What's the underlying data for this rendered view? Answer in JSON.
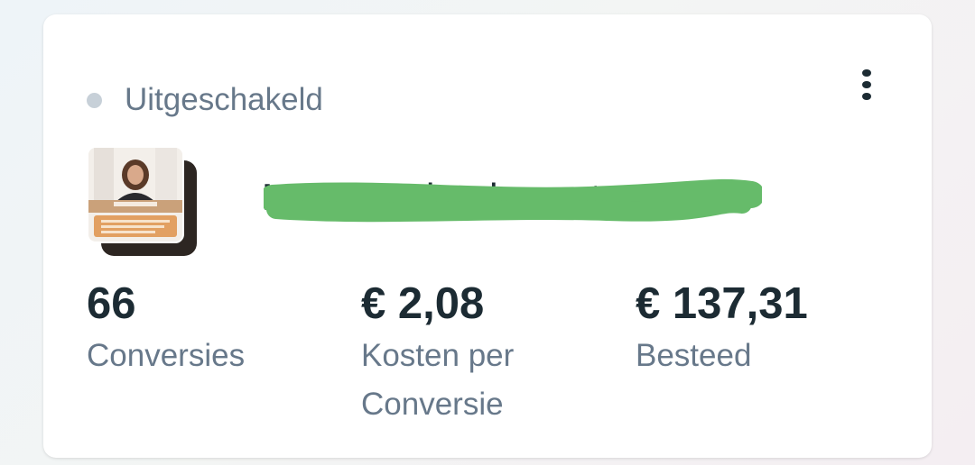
{
  "card": {
    "status": {
      "label": "Uitgeschakeld",
      "dot_color": "#c7d0d8"
    },
    "more_icon": "more-vertical-icon",
    "ad": {
      "name": "MV Downloads ... et",
      "thumbnail_icon": "ad-creative-thumbnail",
      "redaction_color": "#66bb6a"
    },
    "metrics": [
      {
        "value": "66",
        "label": "Conversies"
      },
      {
        "value": "€ 2,08",
        "label": "Kosten per Conversie"
      },
      {
        "value": "€ 137,31",
        "label": "Besteed"
      }
    ]
  }
}
